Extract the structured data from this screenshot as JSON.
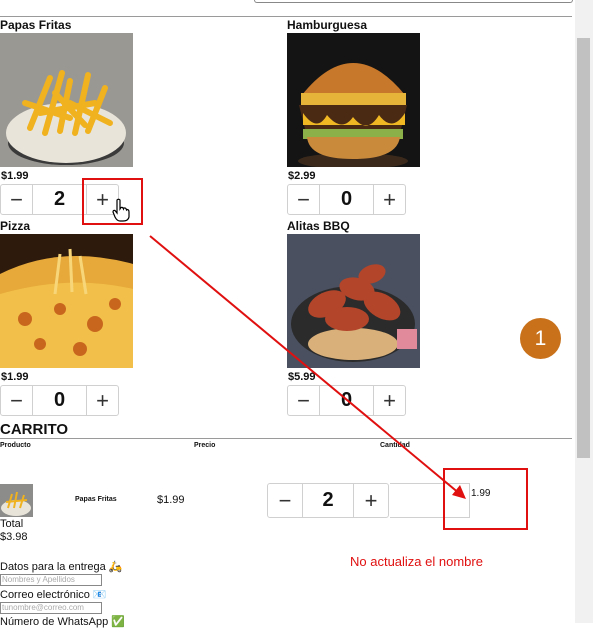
{
  "menu": {
    "products": [
      {
        "name": "Papas Fritas",
        "price": "$1.99",
        "qty": "2"
      },
      {
        "name": "Hamburguesa",
        "price": "$2.99",
        "qty": "0"
      },
      {
        "name": "Pizza",
        "price": "$1.99",
        "qty": "0"
      },
      {
        "name": "Alitas BBQ",
        "price": "$5.99",
        "qty": "0"
      }
    ],
    "minus": "−",
    "plus": "+"
  },
  "cart": {
    "title": "CARRITO",
    "headers": {
      "product": "Producto",
      "price": "Precio",
      "qty": "Cantidad"
    },
    "row": {
      "name": "Papas Fritas",
      "price": "$1.99",
      "qty": "2",
      "subtotal": "1.99"
    },
    "total_label": "Total",
    "total_value": "$3.98"
  },
  "delivery": {
    "title": "Datos para la entrega 🛵",
    "name_placeholder": "Nombres y Apellidos",
    "email_label": "Correo electrónico 📧",
    "email_placeholder": "tunombre@correo.com",
    "whatsapp_label": "Número de WhatsApp ✅"
  },
  "annotation": {
    "badge": "1",
    "note": "No actualiza el nombre",
    "color": "#e01010"
  }
}
